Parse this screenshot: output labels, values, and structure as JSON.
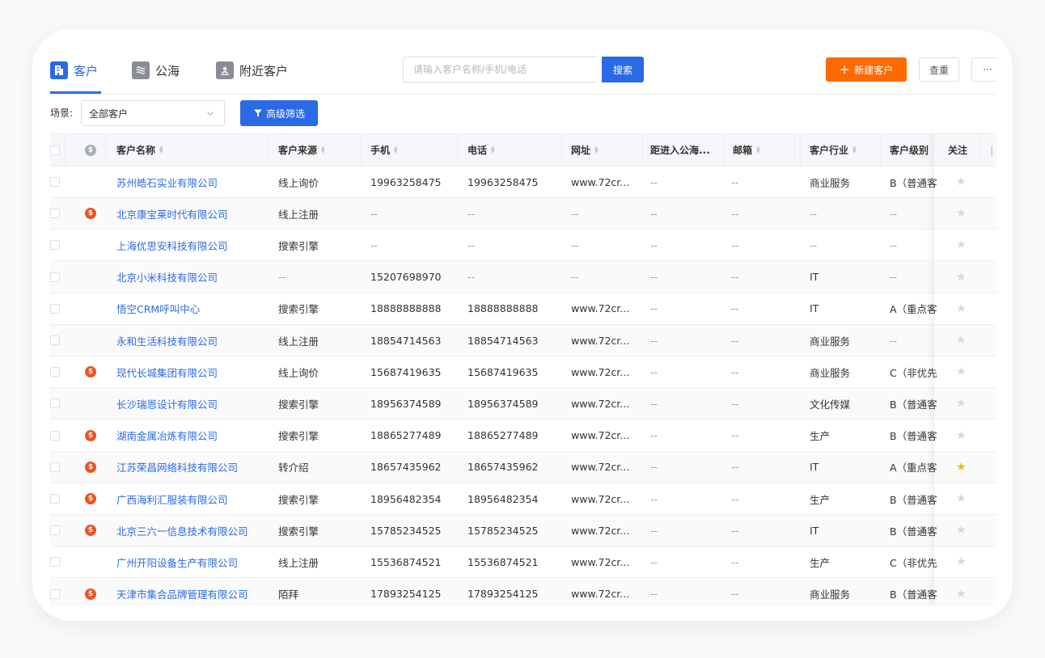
{
  "tabs": [
    {
      "label": "客户",
      "icon": "building-icon",
      "active": true
    },
    {
      "label": "公海",
      "icon": "sea-icon",
      "active": false
    },
    {
      "label": "附近客户",
      "icon": "location-person-icon",
      "active": false
    }
  ],
  "search": {
    "placeholder": "请输入客户名称/手机/电话",
    "value": "",
    "button": "搜索"
  },
  "actions": {
    "new_customer": "新建客户",
    "dedupe": "查重",
    "more": "···"
  },
  "scene": {
    "label": "场景:",
    "value": "全部客户"
  },
  "advanced_filter": "高级筛选",
  "colors": {
    "primary": "#2b6ae6",
    "orange": "#ff6a00",
    "badge": "#f4511e",
    "star_active": "#f5b41d",
    "star_inactive": "#d5d8dd"
  },
  "columns": [
    {
      "key": "name",
      "label": "客户名称",
      "sortable": true
    },
    {
      "key": "source",
      "label": "客户来源",
      "sortable": true
    },
    {
      "key": "mobile",
      "label": "手机",
      "sortable": true
    },
    {
      "key": "phone",
      "label": "电话",
      "sortable": true
    },
    {
      "key": "website",
      "label": "网址",
      "sortable": true
    },
    {
      "key": "pool_days",
      "label": "距进入公海...",
      "sortable": false
    },
    {
      "key": "email",
      "label": "邮箱",
      "sortable": true
    },
    {
      "key": "industry",
      "label": "客户行业",
      "sortable": true
    },
    {
      "key": "level",
      "label": "客户级别",
      "sortable": false
    },
    {
      "key": "follow",
      "label": "关注",
      "sortable": false
    }
  ],
  "header_badge_icon": "dollar-icon",
  "rows": [
    {
      "deal": false,
      "name": "苏州皓石实业有限公司",
      "source": "线上询价",
      "mobile": "19963258475",
      "phone": "19963258475",
      "website": "www.72cr...",
      "pool_days": "--",
      "email": "--",
      "industry": "商业服务",
      "level": "B（普通客",
      "starred": false
    },
    {
      "deal": true,
      "name": "北京康宝莱时代有限公司",
      "source": "线上注册",
      "mobile": "--",
      "phone": "--",
      "website": "--",
      "pool_days": "--",
      "email": "--",
      "industry": "--",
      "level": "--",
      "starred": false
    },
    {
      "deal": false,
      "name": "上海优思安科技有限公司",
      "source": "搜索引擎",
      "mobile": "--",
      "phone": "--",
      "website": "--",
      "pool_days": "--",
      "email": "--",
      "industry": "--",
      "level": "--",
      "starred": false
    },
    {
      "deal": false,
      "name": "北京小米科技有限公司",
      "source": "--",
      "mobile": "15207698970",
      "phone": "--",
      "website": "--",
      "pool_days": "--",
      "email": "--",
      "industry": "IT",
      "level": "--",
      "starred": false
    },
    {
      "deal": false,
      "name": "悟空CRM呼叫中心",
      "source": "搜索引擎",
      "mobile": "18888888888",
      "phone": "18888888888",
      "website": "www.72cr...",
      "pool_days": "--",
      "email": "--",
      "industry": "IT",
      "level": "A（重点客",
      "starred": false
    },
    {
      "deal": false,
      "name": "永和生活科技有限公司",
      "source": "线上注册",
      "mobile": "18854714563",
      "phone": "18854714563",
      "website": "www.72cr...",
      "pool_days": "--",
      "email": "--",
      "industry": "商业服务",
      "level": "--",
      "starred": false
    },
    {
      "deal": true,
      "name": "现代长城集团有限公司",
      "source": "线上询价",
      "mobile": "15687419635",
      "phone": "15687419635",
      "website": "www.72cr...",
      "pool_days": "--",
      "email": "--",
      "industry": "商业服务",
      "level": "C（非优先",
      "starred": false
    },
    {
      "deal": false,
      "name": "长沙瑞恩设计有限公司",
      "source": "搜索引擎",
      "mobile": "18956374589",
      "phone": "18956374589",
      "website": "www.72cr...",
      "pool_days": "--",
      "email": "--",
      "industry": "文化传媒",
      "level": "B（普通客",
      "starred": false
    },
    {
      "deal": true,
      "name": "湖南金属冶炼有限公司",
      "source": "搜索引擎",
      "mobile": "18865277489",
      "phone": "18865277489",
      "website": "www.72cr...",
      "pool_days": "--",
      "email": "--",
      "industry": "生产",
      "level": "B（普通客",
      "starred": false
    },
    {
      "deal": true,
      "name": "江苏荣昌网络科技有限公司",
      "source": "转介绍",
      "mobile": "18657435962",
      "phone": "18657435962",
      "website": "www.72cr...",
      "pool_days": "--",
      "email": "--",
      "industry": "IT",
      "level": "A（重点客",
      "starred": true
    },
    {
      "deal": true,
      "name": "广西海利汇服装有限公司",
      "source": "搜索引擎",
      "mobile": "18956482354",
      "phone": "18956482354",
      "website": "www.72cr...",
      "pool_days": "--",
      "email": "--",
      "industry": "生产",
      "level": "B（普通客",
      "starred": false
    },
    {
      "deal": true,
      "name": "北京三六一信息技术有限公司",
      "source": "搜索引擎",
      "mobile": "15785234525",
      "phone": "15785234525",
      "website": "www.72cr...",
      "pool_days": "--",
      "email": "--",
      "industry": "IT",
      "level": "B（普通客",
      "starred": false
    },
    {
      "deal": false,
      "name": "广州开阳设备生产有限公司",
      "source": "线上注册",
      "mobile": "15536874521",
      "phone": "15536874521",
      "website": "www.72cr...",
      "pool_days": "--",
      "email": "--",
      "industry": "生产",
      "level": "C（非优先",
      "starred": false
    },
    {
      "deal": true,
      "name": "天津市集合品牌管理有限公司",
      "source": "陌拜",
      "mobile": "17893254125",
      "phone": "17893254125",
      "website": "www.72cr...",
      "pool_days": "--",
      "email": "--",
      "industry": "商业服务",
      "level": "B（普通客",
      "starred": false
    }
  ]
}
